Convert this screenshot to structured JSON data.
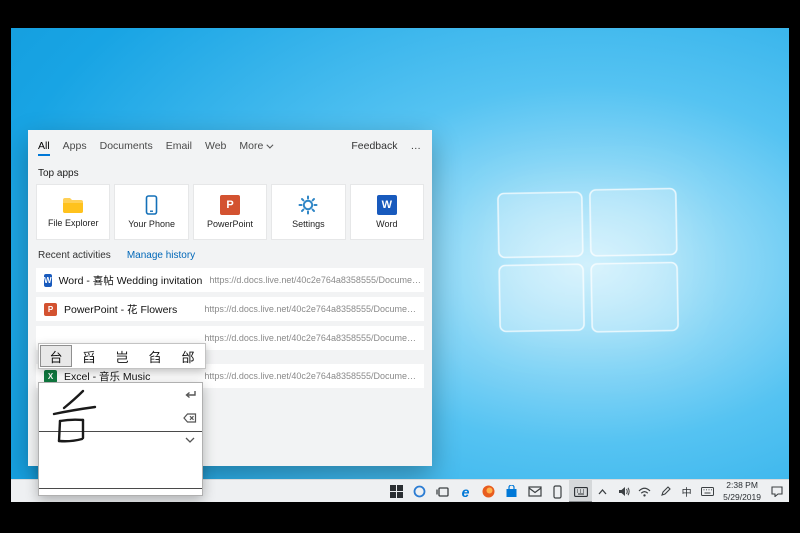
{
  "search_panel": {
    "tabs": {
      "all": "All",
      "apps": "Apps",
      "documents": "Documents",
      "email": "Email",
      "web": "Web",
      "more": "More"
    },
    "feedback": "Feedback",
    "overflow": "…",
    "top_apps": {
      "heading": "Top apps",
      "items": [
        {
          "label": "File Explorer",
          "icon": "file-explorer-icon"
        },
        {
          "label": "Your Phone",
          "icon": "your-phone-icon"
        },
        {
          "label": "PowerPoint",
          "icon": "powerpoint-icon"
        },
        {
          "label": "Settings",
          "icon": "settings-icon"
        },
        {
          "label": "Word",
          "icon": "word-icon"
        }
      ]
    },
    "recent": {
      "heading": "Recent activities",
      "manage": "Manage history",
      "items": [
        {
          "icon": "word-icon",
          "title": "Word - 喜帖 Wedding invitation",
          "url": "https://d.docs.live.net/40c2e764a8358555/Docume…"
        },
        {
          "icon": "powerpoint-icon",
          "title": "PowerPoint - 花 Flowers",
          "url": "https://d.docs.live.net/40c2e764a8358555/Docume…"
        },
        {
          "icon": "hidden",
          "title": "",
          "url": "https://d.docs.live.net/40c2e764a8358555/Docume…"
        },
        {
          "icon": "excel-icon",
          "title": "Excel - 音乐 Music",
          "url": "https://d.docs.live.net/40c2e764a8358555/Docume…"
        }
      ]
    }
  },
  "icon_letters": {
    "word": "W",
    "powerpoint": "P",
    "excel": "X"
  },
  "ime": {
    "candidates": [
      "台",
      "舀",
      "岂",
      "臽",
      "邰"
    ],
    "selected_index": 0,
    "canvas_buttons": [
      "enter-icon",
      "backspace-icon",
      "chevron-down-icon"
    ]
  },
  "taskbar": {
    "edge_glyph": "e",
    "icons": [
      "start",
      "search",
      "task-view",
      "edge",
      "firefox",
      "store",
      "mail",
      "your-phone",
      "touch-keyboard"
    ],
    "active_icon": "touch-keyboard",
    "tray": {
      "icons": [
        "chevron-up",
        "speaker",
        "network",
        "pen",
        "ime-chinese",
        "touch-keyboard",
        "action-center"
      ],
      "ime_label": "中",
      "time": "2:38 PM",
      "date": "5/29/2019"
    }
  },
  "colors": {
    "accent": "#0078d7",
    "desktop_blue": "#18a4e4",
    "taskbar": "#eef0f2"
  }
}
